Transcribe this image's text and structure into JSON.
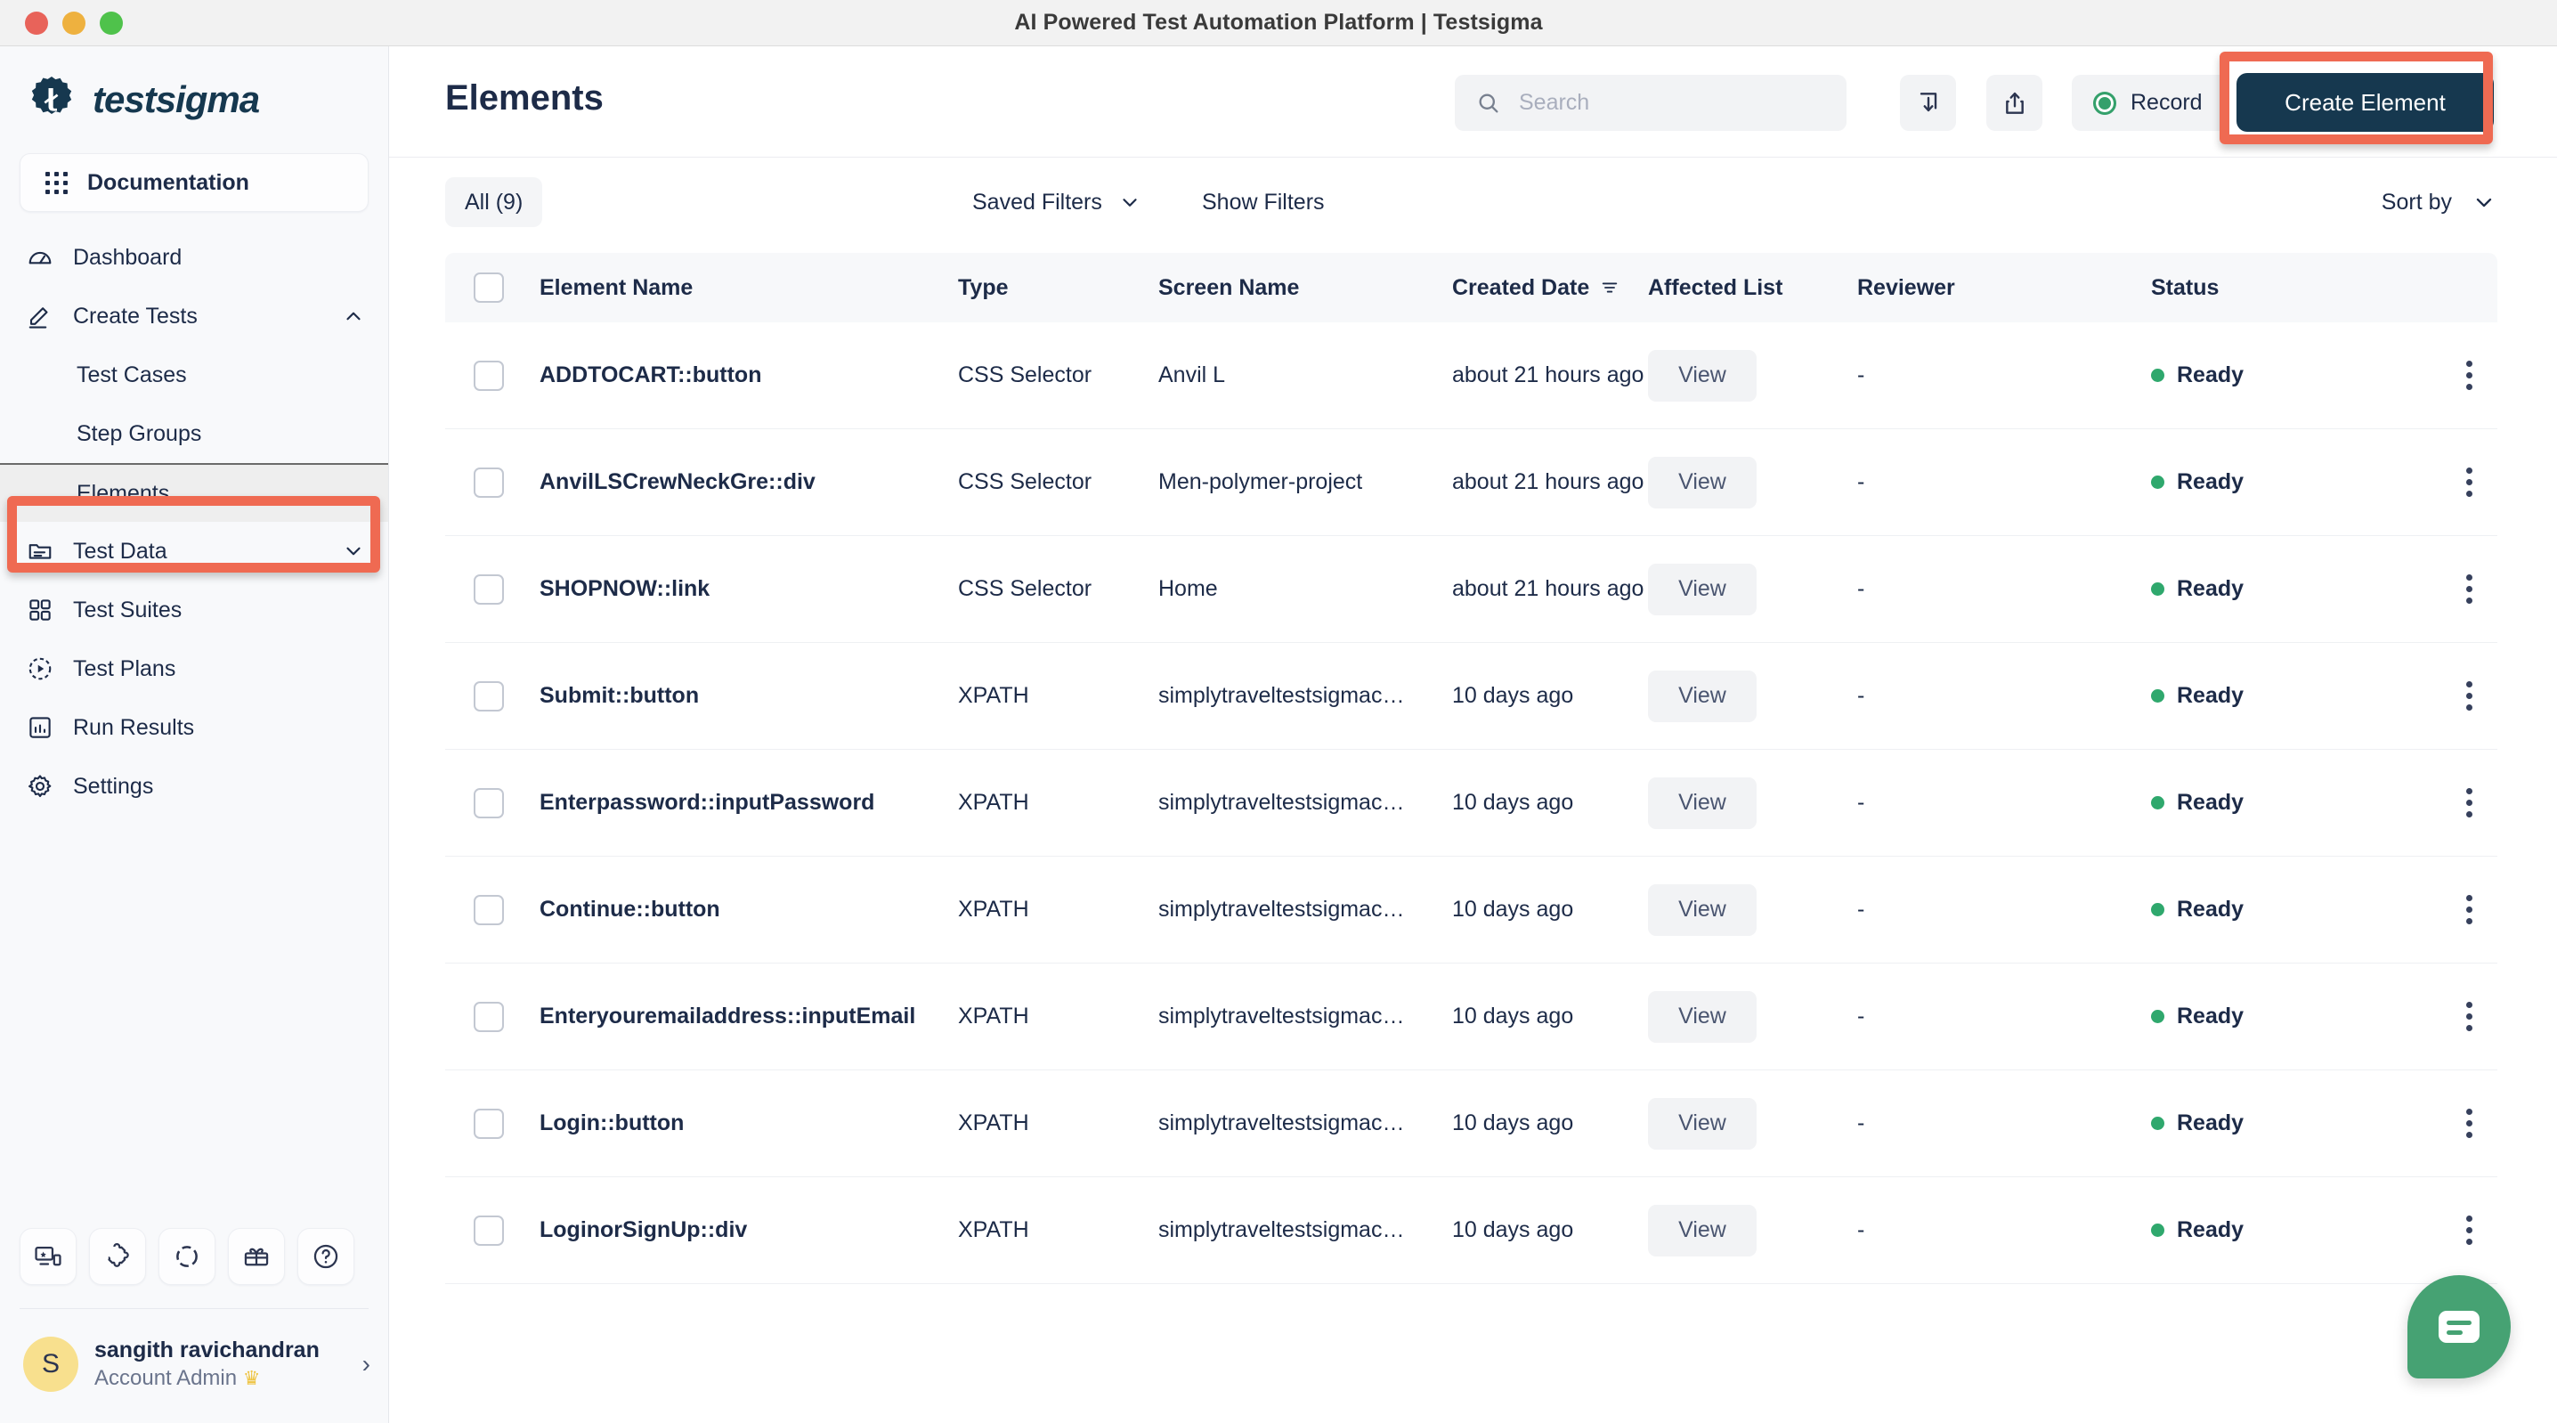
{
  "window": {
    "title": "AI Powered Test Automation Platform | Testsigma",
    "traffic_lights": [
      "close",
      "minimize",
      "zoom"
    ]
  },
  "sidebar": {
    "brand": "testsigma",
    "documentation": {
      "label": "Documentation",
      "icon": "grid-apps-icon"
    },
    "items": [
      {
        "label": "Dashboard",
        "icon": "speedometer-icon",
        "sub": false,
        "chevron": "",
        "active": false
      },
      {
        "label": "Create Tests",
        "icon": "pencil-icon",
        "sub": false,
        "chevron": "expanded",
        "active": false
      },
      {
        "label": "Test Cases",
        "icon": "",
        "sub": true,
        "chevron": "",
        "active": false
      },
      {
        "label": "Step Groups",
        "icon": "",
        "sub": true,
        "chevron": "",
        "active": false
      },
      {
        "label": "Elements",
        "icon": "",
        "sub": true,
        "chevron": "",
        "active": true
      },
      {
        "label": "Test Data",
        "icon": "folder-icon",
        "sub": false,
        "chevron": "collapsed",
        "active": false
      },
      {
        "label": "Test Suites",
        "icon": "grid-squares-icon",
        "sub": false,
        "chevron": "",
        "active": false
      },
      {
        "label": "Test Plans",
        "icon": "play-circle-dashed-icon",
        "sub": false,
        "chevron": "",
        "active": false
      },
      {
        "label": "Run Results",
        "icon": "bar-chart-icon",
        "sub": false,
        "chevron": "",
        "active": false
      },
      {
        "label": "Settings",
        "icon": "gear-icon",
        "sub": false,
        "chevron": "",
        "active": false
      }
    ],
    "tools": [
      {
        "icon": "devices-icon"
      },
      {
        "icon": "puzzle-icon"
      },
      {
        "icon": "dashed-circle-icon"
      },
      {
        "icon": "gift-icon"
      },
      {
        "icon": "help-circle-icon"
      }
    ],
    "account": {
      "initial": "S",
      "name": "sangith ravichandran",
      "role": "Account Admin",
      "crown": "♛",
      "chevron": "›"
    }
  },
  "header": {
    "page_title": "Elements",
    "search": {
      "value": "",
      "placeholder": "Search",
      "icon": "search-icon"
    },
    "download_button": {
      "icon": "download-icon"
    },
    "share_button": {
      "icon": "share-upload-icon"
    },
    "record_button": {
      "label": "Record",
      "icon": "record-dot-icon"
    },
    "create_button": {
      "label": "Create Element"
    }
  },
  "filters": {
    "all_chip": "All (9)",
    "saved_filters": "Saved Filters",
    "saved_filters_chevron": "⌄",
    "show_filters": "Show Filters",
    "sort_by": "Sort by",
    "sort_by_chevron": "⌄"
  },
  "table": {
    "columns": [
      "Element Name",
      "Type",
      "Screen Name",
      "Created Date",
      "Affected List",
      "Reviewer",
      "Status"
    ],
    "created_date_filter_icon": "filter-icon",
    "rows": [
      {
        "name": "ADDTOCART::button",
        "type": "CSS Selector",
        "screen": "Anvil L",
        "created": "about 21 hours ago",
        "affected": "View",
        "reviewer": "-",
        "status": "Ready"
      },
      {
        "name": "AnvilLSCrewNeckGre::div",
        "type": "CSS Selector",
        "screen": "Men-polymer-project",
        "created": "about 21 hours ago",
        "affected": "View",
        "reviewer": "-",
        "status": "Ready"
      },
      {
        "name": "SHOPNOW::link",
        "type": "CSS Selector",
        "screen": "Home",
        "created": "about 21 hours ago",
        "affected": "View",
        "reviewer": "-",
        "status": "Ready"
      },
      {
        "name": "Submit::button",
        "type": "XPATH",
        "screen": "simplytraveltestsigmac…",
        "created": "10 days ago",
        "affected": "View",
        "reviewer": "-",
        "status": "Ready"
      },
      {
        "name": "Enterpassword::inputPassword",
        "type": "XPATH",
        "screen": "simplytraveltestsigmac…",
        "created": "10 days ago",
        "affected": "View",
        "reviewer": "-",
        "status": "Ready"
      },
      {
        "name": "Continue::button",
        "type": "XPATH",
        "screen": "simplytraveltestsigmac…",
        "created": "10 days ago",
        "affected": "View",
        "reviewer": "-",
        "status": "Ready"
      },
      {
        "name": "Enteryouremailaddress::inputEmail",
        "type": "XPATH",
        "screen": "simplytraveltestsigmac…",
        "created": "10 days ago",
        "affected": "View",
        "reviewer": "-",
        "status": "Ready"
      },
      {
        "name": "Login::button",
        "type": "XPATH",
        "screen": "simplytraveltestsigmac…",
        "created": "10 days ago",
        "affected": "View",
        "reviewer": "-",
        "status": "Ready"
      },
      {
        "name": "LoginorSignUp::div",
        "type": "XPATH",
        "screen": "simplytraveltestsigmac…",
        "created": "10 days ago",
        "affected": "View",
        "reviewer": "-",
        "status": "Ready"
      }
    ]
  },
  "chat_widget": {
    "icon": "chat-bubble-icon"
  },
  "colors": {
    "brand_dark": "#16384f",
    "highlight_red": "#ef6a52",
    "status_green": "#2fa86d",
    "record_green": "#34a06b",
    "chat_green": "#46a273",
    "avatar_yellow": "#f8e08e",
    "sidebar_bg": "#f8f9fb",
    "text_primary": "#1d2b48"
  },
  "annotations": [
    {
      "name": "create-element-highlight",
      "target": "Create Element"
    },
    {
      "name": "elements-nav-highlight",
      "target": "Elements"
    }
  ]
}
